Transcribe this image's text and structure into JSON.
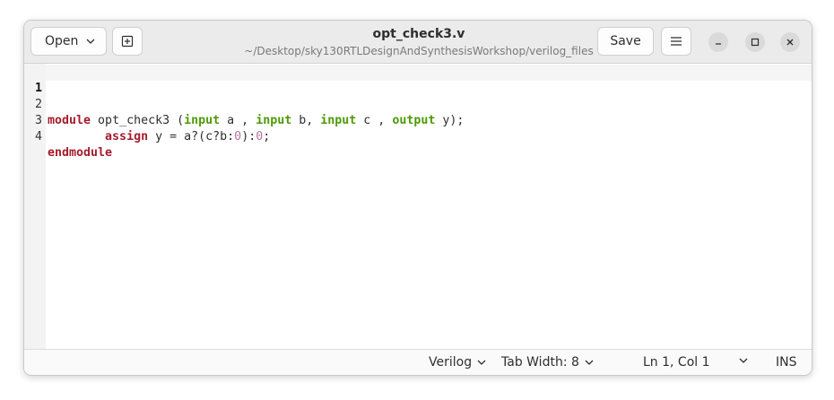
{
  "header": {
    "open_label": "Open",
    "title": "opt_check3.v",
    "path": "~/Desktop/sky130RTLDesignAndSynthesisWorkshop/verilog_files",
    "save_label": "Save"
  },
  "editor": {
    "line_numbers": [
      "1",
      "2",
      "3",
      "4"
    ],
    "lines": {
      "l2": {
        "t1": "module",
        "t2": " opt_check3 (",
        "t3": "input",
        "t4": " a , ",
        "t5": "input",
        "t6": " b, ",
        "t7": "input",
        "t8": " c , ",
        "t9": "output",
        "t10": " y);"
      },
      "l3": {
        "t1": "        ",
        "t2": "assign",
        "t3": " y = a?(c?b:",
        "t4": "0",
        "t5": "):",
        "t6": "0",
        "t7": ";"
      },
      "l4": {
        "t1": "endmodule"
      }
    }
  },
  "statusbar": {
    "language": "Verilog",
    "tab_width": "Tab Width: 8",
    "cursor_position": "Ln 1, Col 1",
    "insert_mode": "INS"
  },
  "colors": {
    "keyword": "#a51d2d",
    "port_keyword": "#4e9a06",
    "number": "#b3749e"
  }
}
